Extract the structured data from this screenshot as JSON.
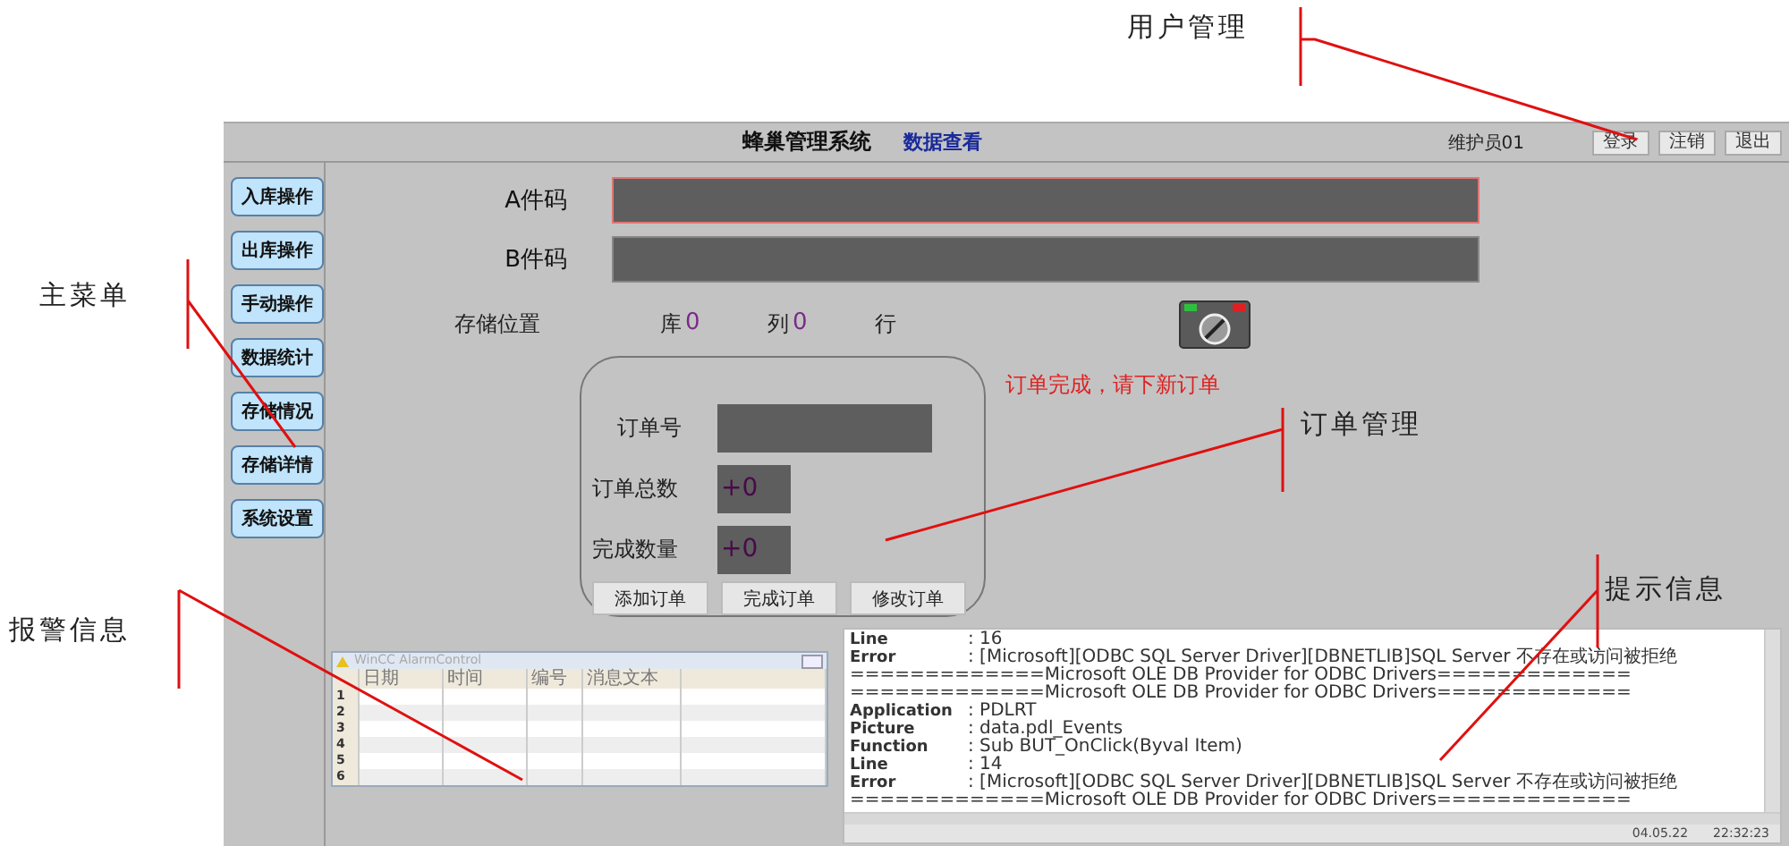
{
  "annotations": [
    {
      "label": "用户管理"
    },
    {
      "label": "主菜单"
    },
    {
      "label": "订单管理"
    },
    {
      "label": "报警信息"
    },
    {
      "label": "提示信息"
    }
  ],
  "header": {
    "title": "蜂巢管理系统",
    "link": "数据查看",
    "user": "维护员01",
    "buttons": [
      "登录",
      "注销",
      "退出"
    ]
  },
  "menu": [
    {
      "label": "入库操作"
    },
    {
      "label": "出库操作"
    },
    {
      "label": "手动操作"
    },
    {
      "label": "数据统计"
    },
    {
      "label": "存储情况"
    },
    {
      "label": "存储详情"
    },
    {
      "label": "系统设置"
    }
  ],
  "codes": [
    {
      "label": "A件码",
      "focused": true
    },
    {
      "label": "B件码",
      "focused": false
    }
  ],
  "storage": {
    "label": "存储位置",
    "parts": [
      {
        "unit": "库",
        "value": "0"
      },
      {
        "unit": "列",
        "value": "0"
      },
      {
        "unit": "行"
      }
    ]
  },
  "order": {
    "fields": [
      {
        "label": "订单号",
        "kind": "wide"
      },
      {
        "label": "订单总数",
        "kind": "short",
        "value": "+0"
      },
      {
        "label": "完成数量",
        "kind": "short",
        "value": "+0"
      }
    ],
    "buttons": [
      "添加订单",
      "完成订单",
      "修改订单"
    ]
  },
  "notice": "订单完成，请下新订单",
  "alarm": {
    "title": "WinCC AlarmControl",
    "columns": [
      "日期",
      "时间",
      "编号",
      "消息文本"
    ],
    "rows": [
      "1",
      "2",
      "3",
      "4",
      "5",
      "6"
    ]
  },
  "messages": {
    "lines": [
      {
        "kind": "pair",
        "key": "Line",
        "value": ": 16"
      },
      {
        "kind": "pair",
        "key": "Error",
        "value": ": [Microsoft][ODBC SQL Server Driver][DBNETLIB]SQL Server 不存在或访问被拒绝"
      },
      {
        "kind": "rule",
        "text": "=============Microsoft OLE DB Provider for ODBC Drivers============="
      },
      {
        "kind": "rule",
        "text": "=============Microsoft OLE DB Provider for ODBC Drivers============="
      },
      {
        "kind": "pair",
        "key": "Application",
        "value": ": PDLRT"
      },
      {
        "kind": "pair",
        "key": "Picture",
        "value": ": data.pdl_Events"
      },
      {
        "kind": "pair",
        "key": "Function",
        "value": ": Sub BUT_OnClick(Byval Item)"
      },
      {
        "kind": "pair",
        "key": "Line",
        "value": ": 14"
      },
      {
        "kind": "pair",
        "key": "Error",
        "value": ": [Microsoft][ODBC SQL Server Driver][DBNETLIB]SQL Server 不存在或访问被拒绝"
      },
      {
        "kind": "rule",
        "text": "=============Microsoft OLE DB Provider for ODBC Drivers============="
      }
    ],
    "date": "04.05.22",
    "time": "22:32:23"
  }
}
